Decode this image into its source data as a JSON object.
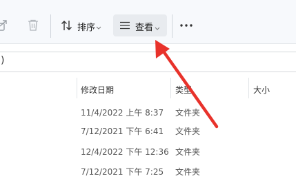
{
  "toolbar": {
    "sort_label": "排序",
    "view_label": "查看",
    "more_label": "···"
  },
  "address": {
    "partial_text": ")"
  },
  "columns": {
    "modified": "修改日期",
    "type": "类型",
    "size": "大小"
  },
  "rows": [
    {
      "date": "11/4/2022 上午 8:37",
      "type": "文件夹"
    },
    {
      "date": "7/12/2021 下午 6:41",
      "type": "文件夹"
    },
    {
      "date": "12/4/2022 下午 12:36",
      "type": "文件夹"
    },
    {
      "date": "7/12/2021 下午 7:25",
      "type": "文件夹"
    }
  ],
  "colors": {
    "annotation_arrow": "#e8322b",
    "toolbar_bg": "#f7f9fc",
    "view_button_bg": "#e8ebef"
  },
  "icons": [
    "share-icon",
    "trash-icon",
    "sort-icon",
    "chevron-down-icon",
    "view-list-icon",
    "more-icon",
    "annotation-arrow-icon"
  ]
}
